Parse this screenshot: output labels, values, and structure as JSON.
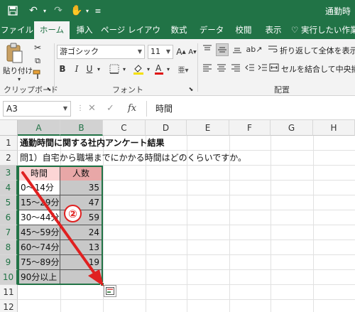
{
  "window": {
    "title": "通勤時"
  },
  "ribbon_tabs": [
    "ファイル",
    "ホーム",
    "挿入",
    "ページ レイアウト",
    "数式",
    "データ",
    "校閲",
    "表示",
    "実行したい作業"
  ],
  "active_tab": "ホーム",
  "clipboard": {
    "paste_label": "貼り付け",
    "group_label": "クリップボード"
  },
  "font": {
    "name": "游ゴシック",
    "size": "11",
    "group_label": "フォント",
    "bold": "B",
    "italic": "I",
    "underline": "U",
    "grow": "A",
    "shrink": "A"
  },
  "alignment": {
    "wrap_label": "折り返して全体を表示す",
    "merge_label": "セルを結合して中央揃え",
    "group_label": "配置"
  },
  "formula_bar": {
    "name_box": "A3",
    "fx_label": "fx",
    "content": "時間"
  },
  "grid": {
    "columns": [
      "A",
      "B",
      "C",
      "D",
      "E",
      "F",
      "G",
      "H"
    ],
    "rows": [
      "1",
      "2",
      "3",
      "4",
      "5",
      "6",
      "7",
      "8",
      "9",
      "10",
      "11",
      "12"
    ],
    "row1": "通勤時間に関する社内アンケート結果",
    "row2": "問1）自宅から職場までにかかる時間はどのくらいですか。",
    "table_header": {
      "a": "時間",
      "b": "人数"
    },
    "table_rows": [
      {
        "a": "0〜14分",
        "b": "35"
      },
      {
        "a": "15〜29分",
        "b": "47"
      },
      {
        "a": "30〜44分",
        "b": "59"
      },
      {
        "a": "45〜59分",
        "b": "24"
      },
      {
        "a": "60〜74分",
        "b": "13"
      },
      {
        "a": "75〜89分",
        "b": "19"
      },
      {
        "a": "90分以上",
        "b": ""
      }
    ]
  },
  "annotation": {
    "step_marker": "②",
    "arrow_color": "#e02020"
  },
  "colors": {
    "brand": "#217346",
    "header_pink_a": "#fcd5d5",
    "header_pink_b": "#e8a7a7",
    "fill_grey": "#c8c8c8"
  }
}
